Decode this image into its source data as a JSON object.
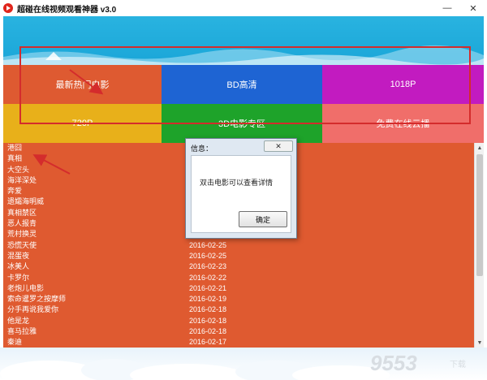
{
  "window": {
    "title": "超碰在线视频观看神器 v3.0",
    "minimize": "—",
    "close": "✕"
  },
  "tiles": [
    {
      "label": "最新热门电影",
      "color": "#de5a31"
    },
    {
      "label": "BD高清",
      "color": "#1e64d3"
    },
    {
      "label": "1018P",
      "color": "#c21bc0"
    },
    {
      "label": "720P",
      "color": "#e8b01a"
    },
    {
      "label": "3D电影专区",
      "color": "#1ea32a"
    },
    {
      "label": "免费在线云播",
      "color": "#f06e6a"
    }
  ],
  "movies": [
    {
      "name": "港囧",
      "date": ""
    },
    {
      "name": "真相",
      "date": ""
    },
    {
      "name": "大空头",
      "date": ""
    },
    {
      "name": "海洋深处",
      "date": ""
    },
    {
      "name": "奔爱",
      "date": ""
    },
    {
      "name": "遗孀海明威",
      "date": ""
    },
    {
      "name": "真相禁区",
      "date": ""
    },
    {
      "name": "恶人报青",
      "date": ""
    },
    {
      "name": "荒村换灵",
      "date": ""
    },
    {
      "name": "恐慌天使",
      "date": "2016-02-25"
    },
    {
      "name": "混蛋夜",
      "date": "2016-02-25"
    },
    {
      "name": "冰美人",
      "date": "2016-02-23"
    },
    {
      "name": "卡罗尔",
      "date": "2016-02-22"
    },
    {
      "name": "老炮儿电影",
      "date": "2016-02-21"
    },
    {
      "name": "索命暹罗之按摩师",
      "date": "2016-02-19"
    },
    {
      "name": "分手再说我爱你",
      "date": "2016-02-18"
    },
    {
      "name": "他是龙",
      "date": "2016-02-18"
    },
    {
      "name": "喜马拉雅",
      "date": "2016-02-18"
    },
    {
      "name": "秦迪",
      "date": "2016-02-17"
    }
  ],
  "dialog": {
    "title": "信息：",
    "close": "✕",
    "message": "双击电影可以查看详情",
    "ok": "确定"
  },
  "watermark": {
    "main": "9553",
    "sub": "下载"
  },
  "colors": {
    "list_bg": "#df5a30",
    "annotation": "#d42c2c",
    "banner": "#1aa6d8"
  }
}
